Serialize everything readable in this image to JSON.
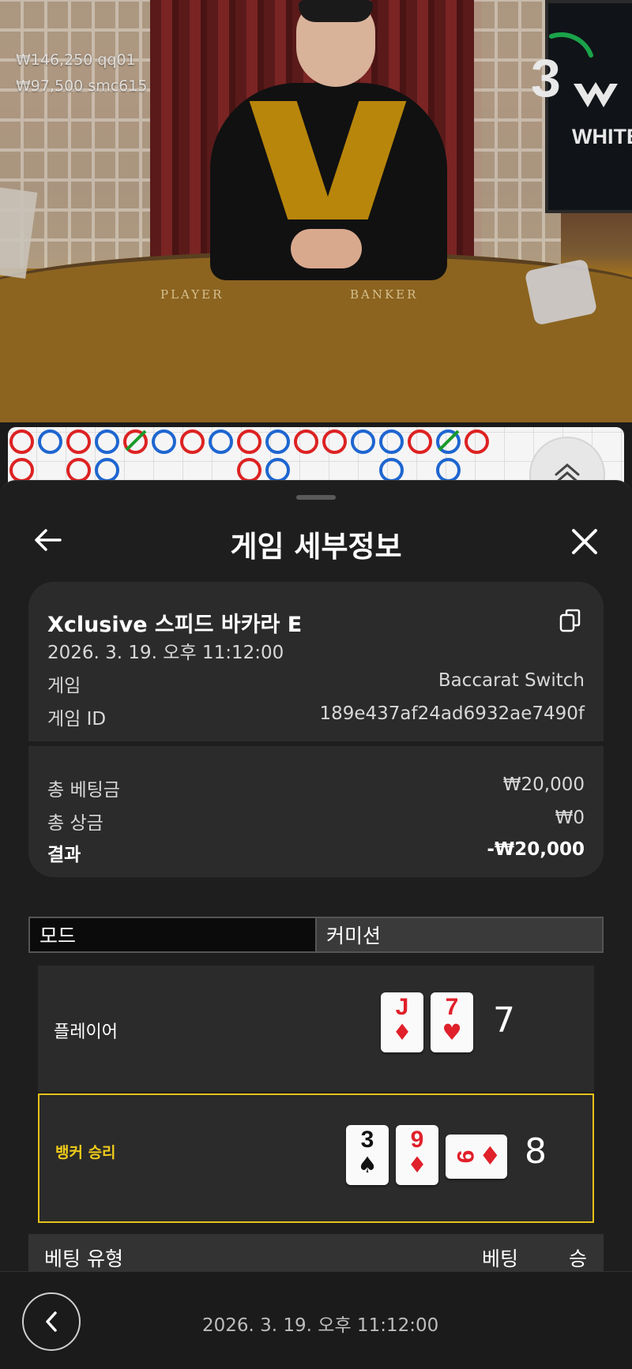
{
  "video": {
    "bets": [
      {
        "amount": "₩146,250",
        "user": "qq01"
      },
      {
        "amount": "₩97,500",
        "user": "smc615"
      }
    ],
    "countdown": "3",
    "brand_text": "WHITE",
    "table_labels": {
      "player": "PLAYER",
      "banker": "BANKER"
    }
  },
  "sheet": {
    "title": "게임 세부정보",
    "summary": {
      "game_name": "Xclusive 스피드 바카라 E",
      "datetime": "2026. 3. 19. 오후 11:12:00",
      "game_label": "게임",
      "game_value": "Baccarat Switch",
      "game_id_label": "게임 ID",
      "game_id_value": "189e437af24ad6932ae7490f",
      "total_bet_label": "총 베팅금",
      "total_bet_value": "₩20,000",
      "total_win_label": "총 상금",
      "total_win_value": "₩0",
      "result_label": "결과",
      "result_value": "-₩20,000"
    },
    "tabs": [
      {
        "label": "모드",
        "active": true
      },
      {
        "label": "커미션",
        "active": false
      }
    ],
    "player": {
      "label": "플레이어",
      "cards": [
        {
          "rank": "J",
          "suit": "♦",
          "color": "red"
        },
        {
          "rank": "7",
          "suit": "♥",
          "color": "red"
        }
      ],
      "score": "7"
    },
    "banker": {
      "label": "뱅커 승리",
      "cards": [
        {
          "rank": "3",
          "suit": "♠",
          "color": "black"
        },
        {
          "rank": "9",
          "suit": "♦",
          "color": "red"
        },
        {
          "rank": "9",
          "suit": "♦",
          "color": "red"
        }
      ],
      "score": "8"
    },
    "bet_table_headers": {
      "type": "베팅 유형",
      "bet": "베팅",
      "win": "승"
    }
  },
  "footer": {
    "datetime": "2026. 3. 19. 오후 11:12:00"
  },
  "colors": {
    "accent_yellow": "#e6c319",
    "player_blue": "#1e66d0",
    "banker_red": "#d22222"
  }
}
